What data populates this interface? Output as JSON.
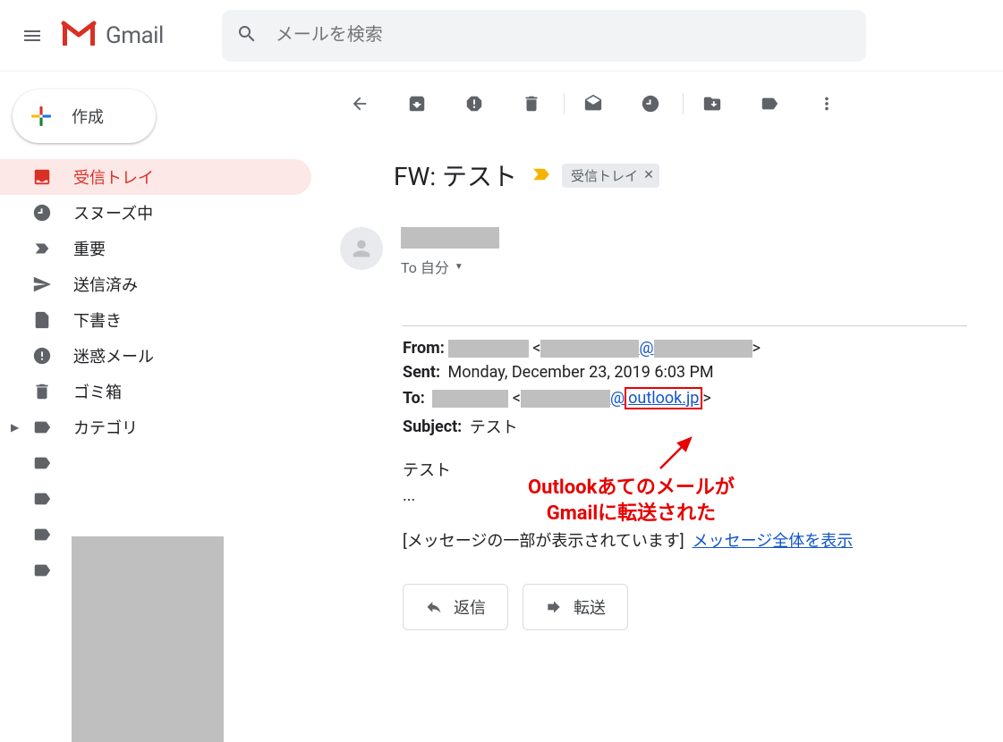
{
  "header": {
    "app_name": "Gmail",
    "search_placeholder": "メールを検索"
  },
  "compose": {
    "label": "作成"
  },
  "sidebar": {
    "items": [
      {
        "label": "受信トレイ"
      },
      {
        "label": "スヌーズ中"
      },
      {
        "label": "重要"
      },
      {
        "label": "送信済み"
      },
      {
        "label": "下書き"
      },
      {
        "label": "迷惑メール"
      },
      {
        "label": "ゴミ箱"
      }
    ],
    "category_label": "カテゴリ"
  },
  "email": {
    "subject": "FW: テスト",
    "label_chip": "受信トレイ",
    "to_line": "To 自分",
    "from_label": "From:",
    "sent_label": "Sent:",
    "sent_value": "Monday, December 23, 2019 6:03 PM",
    "to_label": "To:",
    "at_sign": "@",
    "outlook_domain": "outlook.jp",
    "subject_label": "Subject:",
    "subject_value": "テスト",
    "body_line1": "テスト",
    "body_line2": "...",
    "partial_prefix": "[メッセージの一部が表示されています]",
    "show_full_link": "メッセージ全体を表示",
    "reply_label": "返信",
    "forward_label": "転送"
  },
  "annotation": {
    "line1": "Outlookあてのメールが",
    "line2": "Gmailに転送された"
  }
}
